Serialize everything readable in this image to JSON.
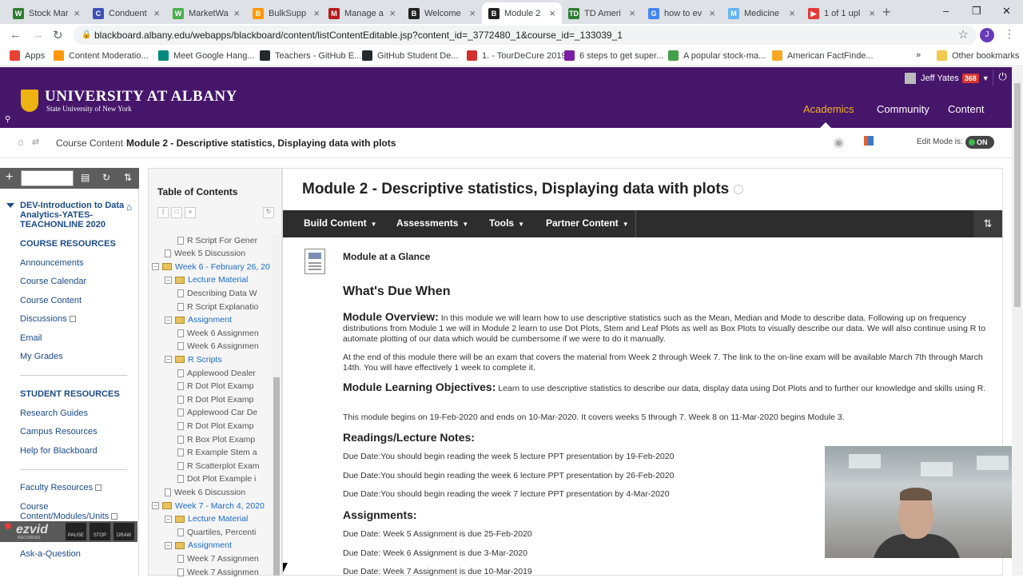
{
  "browser": {
    "tabs": [
      {
        "title": "Stock Mar",
        "color": "#2e7d32",
        "glyph": "W"
      },
      {
        "title": "Conduent",
        "color": "#3f51b5",
        "glyph": "C"
      },
      {
        "title": "MarketWa",
        "color": "#4caf50",
        "glyph": "W"
      },
      {
        "title": "BulkSupp",
        "color": "#ff9800",
        "glyph": "B"
      },
      {
        "title": "Manage a",
        "color": "#b71c1c",
        "glyph": "M"
      },
      {
        "title": "Welcome",
        "color": "#222222",
        "glyph": "B"
      },
      {
        "title": "Module 2",
        "color": "#222222",
        "glyph": "B"
      },
      {
        "title": "TD Ameri",
        "color": "#2e7d32",
        "glyph": "TD"
      },
      {
        "title": "how to ev",
        "color": "#4285f4",
        "glyph": "G"
      },
      {
        "title": "Medicine",
        "color": "#64b5f6",
        "glyph": "M"
      },
      {
        "title": "1 of 1 upl",
        "color": "#e53935",
        "glyph": "▶"
      }
    ],
    "new_tab": "+",
    "window_controls": [
      "–",
      "❐",
      "✕"
    ],
    "url": "blackboard.albany.edu/webapps/blackboard/content/listContentEditable.jsp?content_id=_3772480_1&course_id=_133039_1",
    "profile_initial": "J",
    "bookmarks": [
      {
        "label": "Apps",
        "color": "#ea4335"
      },
      {
        "label": "Content Moderatio...",
        "color": "#ff9800"
      },
      {
        "label": "Meet Google Hang...",
        "color": "#00897b"
      },
      {
        "label": "Teachers - GitHub E...",
        "color": "#24292e"
      },
      {
        "label": "GitHub Student De...",
        "color": "#24292e"
      },
      {
        "label": "1. - TourDeCure 2019",
        "color": "#d32f2f"
      },
      {
        "label": "6 steps to get super...",
        "color": "#7b1fa2"
      },
      {
        "label": "A popular stock-ma...",
        "color": "#43a047"
      },
      {
        "label": "American FactFinde...",
        "color": "#f9a825"
      }
    ],
    "bookmarks_more": "»",
    "other_bookmarks": "Other bookmarks"
  },
  "header": {
    "logo_main": "UNIVERSITY AT ALBANY",
    "logo_sub": "State University of New York",
    "user_name": "Jeff Yates",
    "notification_count": "368",
    "nav": [
      "Academics",
      "Community",
      "Content"
    ],
    "brand_color": "#46166b",
    "accent_color": "#f2b31a"
  },
  "breadcrumb": {
    "items": [
      "Course Content",
      "Module 2 - Descriptive statistics, Displaying data with plots"
    ],
    "separator": "›",
    "edit_mode_label": "Edit Mode is:",
    "edit_mode_value": "ON"
  },
  "course_menu": {
    "course_name": "DEV-Introduction to Data Analytics-YATES-TEACHONLINE 2020",
    "section1_heading": "COURSE RESOURCES",
    "section1_items": [
      "Announcements",
      "Course Calendar",
      "Course Content",
      "Discussions",
      "Email",
      "My Grades"
    ],
    "section2_heading": "STUDENT RESOURCES",
    "section2_items": [
      "Research Guides",
      "Campus Resources",
      "Help for Blackboard"
    ],
    "section3_items": [
      "Faculty Resources",
      "Course Content/Modules/Units",
      "Ask-a-Question"
    ]
  },
  "ezvid": {
    "brand": "ezvid",
    "sub": "RECORDER",
    "controls": [
      "PAUSE",
      "STOP",
      "DRAW"
    ]
  },
  "toc": {
    "title": "Table of Contents",
    "rows": [
      {
        "label": "R Script For Gener",
        "type": "doc",
        "indent": 3
      },
      {
        "label": "Week 5 Discussion",
        "type": "doc",
        "indent": 2
      },
      {
        "label": "Week 6 - February 26, 20",
        "type": "folder",
        "indent": 1
      },
      {
        "label": "Lecture Material",
        "type": "folder",
        "indent": 2
      },
      {
        "label": "Describing Data W",
        "type": "doc",
        "indent": 3
      },
      {
        "label": "R Script Explanatio",
        "type": "doc",
        "indent": 3
      },
      {
        "label": "Assignment",
        "type": "folder",
        "indent": 2
      },
      {
        "label": "Week 6 Assignmen",
        "type": "doc",
        "indent": 3
      },
      {
        "label": "Week 6 Assignmen",
        "type": "doc",
        "indent": 3
      },
      {
        "label": "R Scripts",
        "type": "folder",
        "indent": 2
      },
      {
        "label": "Applewood Dealer",
        "type": "doc",
        "indent": 3
      },
      {
        "label": "R Dot Plot Examp",
        "type": "doc",
        "indent": 3
      },
      {
        "label": "R Dot Plot Examp",
        "type": "doc",
        "indent": 3
      },
      {
        "label": "Applewood Car De",
        "type": "doc",
        "indent": 3
      },
      {
        "label": "R Dot Plot Examp",
        "type": "doc",
        "indent": 3
      },
      {
        "label": "R Box Plot Examp",
        "type": "doc",
        "indent": 3
      },
      {
        "label": "R Example Stem a",
        "type": "doc",
        "indent": 3
      },
      {
        "label": "R Scatterplot Exam",
        "type": "doc",
        "indent": 3
      },
      {
        "label": "Dot Plot Example i",
        "type": "doc",
        "indent": 3
      },
      {
        "label": "Week 6 Discussion",
        "type": "doc",
        "indent": 2
      },
      {
        "label": "Week 7 - March 4, 2020",
        "type": "folder",
        "indent": 1
      },
      {
        "label": "Lecture Material",
        "type": "folder",
        "indent": 2
      },
      {
        "label": "Quartiles, Percenti",
        "type": "doc",
        "indent": 3
      },
      {
        "label": "Assignment",
        "type": "folder",
        "indent": 2
      },
      {
        "label": "Week 7 Assignmen",
        "type": "doc",
        "indent": 3
      },
      {
        "label": "Week 7 Assignmen",
        "type": "doc",
        "indent": 3
      }
    ]
  },
  "main": {
    "title": "Module 2 - Descriptive statistics, Displaying data with plots",
    "actions": [
      "Build Content",
      "Assessments",
      "Tools",
      "Partner Content"
    ],
    "item_title": "Module at a Glance",
    "h_due": "What's Due When",
    "overview_label": "Module Overview:",
    "overview_text": "In this module we will learn how to use descriptive statistics such as the Mean, Median and Mode to describe data.  Following up on frequency distributions from Module 1 we will in Module 2 learn to use Dot Plots, Stem and Leaf Plots as well as Box Plots to visually describe our data.  We will also continue using R to automate plotting of our data which would be cumbersome if we were to do it manually.",
    "exam_text": "At the end of this module there will be an exam that covers the material from Week 2 through Week 7.  The link to the on-line exam will be available March 7th through March 14th.  You will have effectively 1 week to complete it.",
    "objectives_label": "Module Learning Objectives:",
    "objectives_text": "Learn to use descriptive statistics to describe our data, display data using Dot Plots and to further our knowledge and skills using R.",
    "dates_text": "This module begins on 19-Feb-2020 and ends on 10-Mar-2020.  It covers weeks 5 through 7.  Week 8 on 11-Mar-2020 begins Module 3.",
    "readings_heading": "Readings/Lecture Notes:",
    "readings": [
      "Due Date:You should begin reading the week 5 lecture PPT presentation by 19-Feb-2020",
      "Due Date:You should begin reading the week 6 lecture PPT presentation by 26-Feb-2020",
      "Due Date:You should begin reading the week 7 lecture PPT presentation by 4-Mar-2020"
    ],
    "assignments_heading": "Assignments:",
    "assignments": [
      "Due Date: Week 5 Assignment is due 25-Feb-2020",
      "Due Date: Week 6 Assignment is due 3-Mar-2020",
      "Due Date: Week 7 Assignment is due 10-Mar-2019"
    ]
  }
}
